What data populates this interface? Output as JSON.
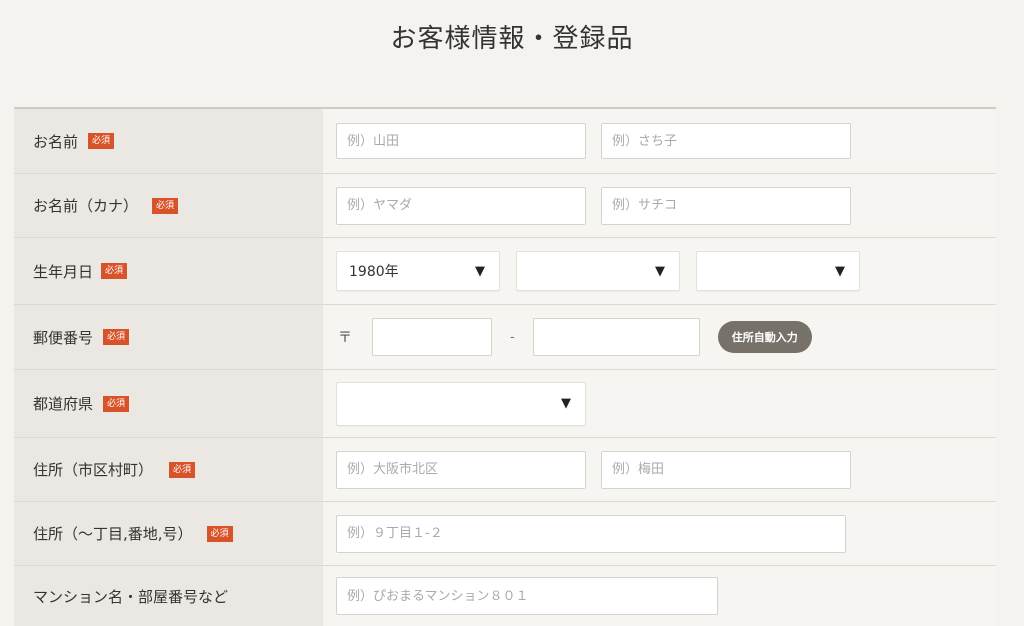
{
  "page": {
    "title": "お客様情報・登録品"
  },
  "required_label": "必須",
  "rows": {
    "name": {
      "label": "お名前",
      "ph1": "例）山田",
      "ph2": "例）さち子"
    },
    "kana": {
      "label": "お名前（カナ）",
      "ph1": "例）ヤマダ",
      "ph2": "例）サチコ"
    },
    "birth": {
      "label": "生年月日",
      "year": "1980年",
      "month": "",
      "day": ""
    },
    "zip": {
      "label": "郵便番号",
      "mark": "〒",
      "dash": "-",
      "button": "住所自動入力"
    },
    "pref": {
      "label": "都道府県",
      "value": ""
    },
    "city": {
      "label": "住所（市区村町）",
      "ph1": "例）大阪市北区",
      "ph2": "例）梅田"
    },
    "street": {
      "label": "住所（〜丁目,番地,号）",
      "ph": "例）９丁目１-２"
    },
    "building": {
      "label": "マンション名・部屋番号など",
      "ph": "例）ぴおまるマンション８０１"
    }
  },
  "icons": {
    "dropdown": "triangle-down-icon"
  },
  "colors": {
    "required_badge": "#d9532a",
    "button": "#76726a"
  }
}
